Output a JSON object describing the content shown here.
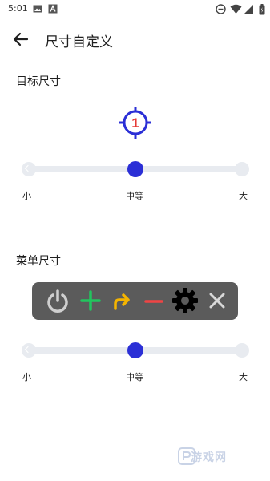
{
  "status_bar": {
    "time": "5:01",
    "icons": [
      "image-notification-icon",
      "text-notification-icon",
      "do-not-disturb-icon",
      "wifi-icon",
      "signal-icon",
      "battery-icon"
    ]
  },
  "app_bar": {
    "title": "尺寸自定义",
    "back_icon": "arrow-back-icon"
  },
  "target_size": {
    "label": "目标尺寸",
    "preview_number": "1",
    "slider": {
      "min_label": "小",
      "mid_label": "中等",
      "max_label": "大",
      "value_fraction": 0.5
    }
  },
  "menu_size": {
    "label": "菜单尺寸",
    "preview_icons": [
      "power-icon",
      "plus-icon",
      "redo-arrow-icon",
      "minus-icon",
      "gear-icon",
      "close-icon"
    ],
    "slider": {
      "min_label": "小",
      "mid_label": "中等",
      "max_label": "大",
      "value_fraction": 0.5
    }
  },
  "watermark": {
    "text": "游戏网"
  },
  "colors": {
    "accent": "#2b2fd6",
    "target_number": "#e53935",
    "track": "#e8ebf0",
    "menu_bg": "#5b5b5b",
    "plus": "#22c55e",
    "redo": "#f4b400",
    "minus": "#ef4444"
  }
}
